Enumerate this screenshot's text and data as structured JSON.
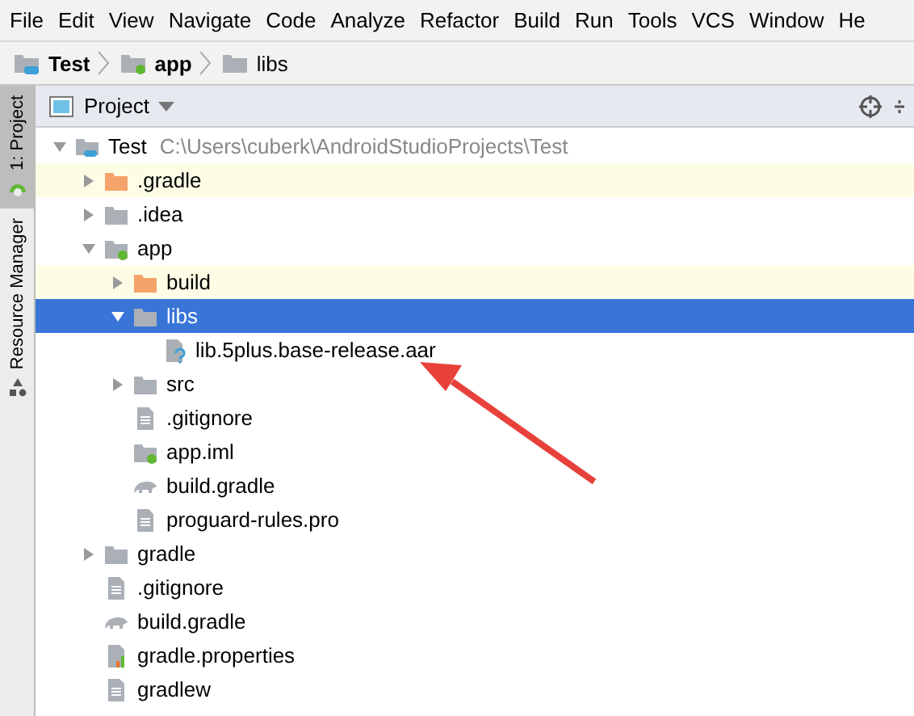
{
  "menu": [
    {
      "label": "File"
    },
    {
      "label": "Edit"
    },
    {
      "label": "View"
    },
    {
      "label": "Navigate"
    },
    {
      "label": "Code"
    },
    {
      "label": "Analyze"
    },
    {
      "label": "Refactor"
    },
    {
      "label": "Build"
    },
    {
      "label": "Run"
    },
    {
      "label": "Tools"
    },
    {
      "label": "VCS"
    },
    {
      "label": "Window"
    },
    {
      "label": "He"
    }
  ],
  "breadcrumb": [
    {
      "label": "Test",
      "kind": "project"
    },
    {
      "label": "app",
      "kind": "module"
    },
    {
      "label": "libs",
      "kind": "folder"
    }
  ],
  "side_tabs": [
    {
      "label": "1: Project",
      "selected": true,
      "kind": "project"
    },
    {
      "label": "Resource Manager",
      "selected": false,
      "kind": "resources"
    }
  ],
  "panel": {
    "title": "Project"
  },
  "tree": [
    {
      "label": "Test",
      "path": "C:\\Users\\cuberk\\AndroidStudioProjects\\Test",
      "kind": "project",
      "expanded": true,
      "children": [
        {
          "label": ".gradle",
          "kind": "folder",
          "expanded": false,
          "excluded": true,
          "selected": false
        },
        {
          "label": ".idea",
          "kind": "folder",
          "expanded": false,
          "excluded": false,
          "selected": false
        },
        {
          "label": "app",
          "kind": "module",
          "expanded": true,
          "excluded": false,
          "selected": false,
          "children": [
            {
              "label": "build",
              "kind": "folder",
              "expanded": false,
              "excluded": true,
              "selected": false
            },
            {
              "label": "libs",
              "kind": "folder",
              "expanded": true,
              "excluded": false,
              "selected": true,
              "children": [
                {
                  "label": "lib.5plus.base-release.aar",
                  "kind": "unknown",
                  "excluded": false,
                  "selected": false
                }
              ]
            },
            {
              "label": "src",
              "kind": "folder",
              "expanded": false,
              "excluded": false,
              "selected": false
            },
            {
              "label": ".gitignore",
              "kind": "text",
              "excluded": false,
              "selected": false
            },
            {
              "label": "app.iml",
              "kind": "iml",
              "excluded": false,
              "selected": false
            },
            {
              "label": "build.gradle",
              "kind": "gradle",
              "excluded": false,
              "selected": false
            },
            {
              "label": "proguard-rules.pro",
              "kind": "text",
              "excluded": false,
              "selected": false
            }
          ]
        },
        {
          "label": "gradle",
          "kind": "folder",
          "expanded": false,
          "excluded": false,
          "selected": false
        },
        {
          "label": ".gitignore",
          "kind": "text",
          "excluded": false,
          "selected": false
        },
        {
          "label": "build.gradle",
          "kind": "gradle",
          "excluded": false,
          "selected": false
        },
        {
          "label": "gradle.properties",
          "kind": "properties",
          "excluded": false,
          "selected": false
        },
        {
          "label": "gradlew",
          "kind": "text",
          "excluded": false,
          "selected": false
        }
      ]
    }
  ]
}
